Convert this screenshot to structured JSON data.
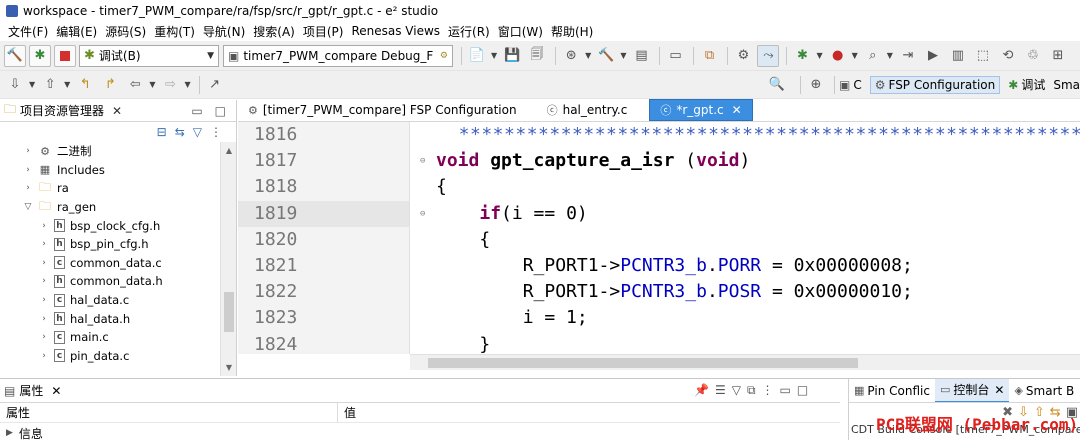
{
  "window": {
    "title": "workspace - timer7_PWM_compare/ra/fsp/src/r_gpt/r_gpt.c - e² studio"
  },
  "menu": [
    "文件(F)",
    "编辑(E)",
    "源码(S)",
    "重构(T)",
    "导航(N)",
    "搜索(A)",
    "项目(P)",
    "Renesas Views",
    "运行(R)",
    "窗口(W)",
    "帮助(H)"
  ],
  "toolbar": {
    "run_mode": "调试(B)",
    "launch_config": "timer7_PWM_compare Debug_F",
    "perspectives": [
      {
        "label": "C",
        "icon": "c-perspective-icon",
        "active": false
      },
      {
        "label": "FSP Configuration",
        "icon": "fsp-gear-icon",
        "active": true
      },
      {
        "label": "调试",
        "icon": "debug-bug-icon",
        "active": false
      },
      {
        "label": "Sma",
        "icon": "smart-icon",
        "active": false
      }
    ]
  },
  "project_explorer": {
    "title": "项目资源管理器",
    "items": [
      {
        "label": "二进制",
        "icon": "binary-icon",
        "indent": 1,
        "expanded": false
      },
      {
        "label": "Includes",
        "icon": "includes-icon",
        "indent": 1,
        "expanded": false
      },
      {
        "label": "ra",
        "icon": "folder-icon",
        "indent": 1,
        "expanded": false
      },
      {
        "label": "ra_gen",
        "icon": "folder-icon",
        "indent": 1,
        "expanded": true
      },
      {
        "label": "bsp_clock_cfg.h",
        "icon": "h-file-icon",
        "indent": 2,
        "expanded": false
      },
      {
        "label": "bsp_pin_cfg.h",
        "icon": "h-file-icon",
        "indent": 2,
        "expanded": false
      },
      {
        "label": "common_data.c",
        "icon": "c-file-icon",
        "indent": 2,
        "expanded": false
      },
      {
        "label": "common_data.h",
        "icon": "h-file-icon",
        "indent": 2,
        "expanded": false
      },
      {
        "label": "hal_data.c",
        "icon": "c-file-icon",
        "indent": 2,
        "expanded": false
      },
      {
        "label": "hal_data.h",
        "icon": "h-file-icon",
        "indent": 2,
        "expanded": false
      },
      {
        "label": "main.c",
        "icon": "c-file-icon",
        "indent": 2,
        "expanded": false
      },
      {
        "label": "pin_data.c",
        "icon": "c-file-icon",
        "indent": 2,
        "expanded": false
      }
    ]
  },
  "editor": {
    "tabs": [
      {
        "label": "[timer7_PWM_compare] FSP Configuration",
        "icon": "fsp-gear-icon",
        "active": false
      },
      {
        "label": "hal_entry.c",
        "icon": "c-file-icon",
        "active": false
      },
      {
        "label": "*r_gpt.c",
        "icon": "c-file-icon",
        "active": true
      }
    ],
    "line_numbers": [
      "1816",
      "1817",
      "1818",
      "1819",
      "1820",
      "1821",
      "1822",
      "1823",
      "1824"
    ],
    "highlighted_line": "1819",
    "code": [
      "  ****************************************************************",
      "void gpt_capture_a_isr (void)",
      "{",
      "    if(i == 0)",
      "    {",
      "        R_PORT1->PCNTR3_b.PORR = 0x00000008;",
      "        R_PORT1->PCNTR3_b.POSR = 0x00000010;",
      "        i = 1;",
      "    }"
    ]
  },
  "properties": {
    "title": "属性",
    "col_property": "属性",
    "col_value": "值",
    "row_label": "信息"
  },
  "right_panel": {
    "tabs": [
      {
        "label": "Pin Conflic",
        "icon": "pin-icon",
        "active": false
      },
      {
        "label": "控制台",
        "icon": "console-icon",
        "active": true
      },
      {
        "label": "Smart B",
        "icon": "smart-icon",
        "active": false
      }
    ],
    "status": "CDT Build Console [timer7_PWM_compare]"
  },
  "watermark": "PCB联盟网 (Pebbar.com)"
}
